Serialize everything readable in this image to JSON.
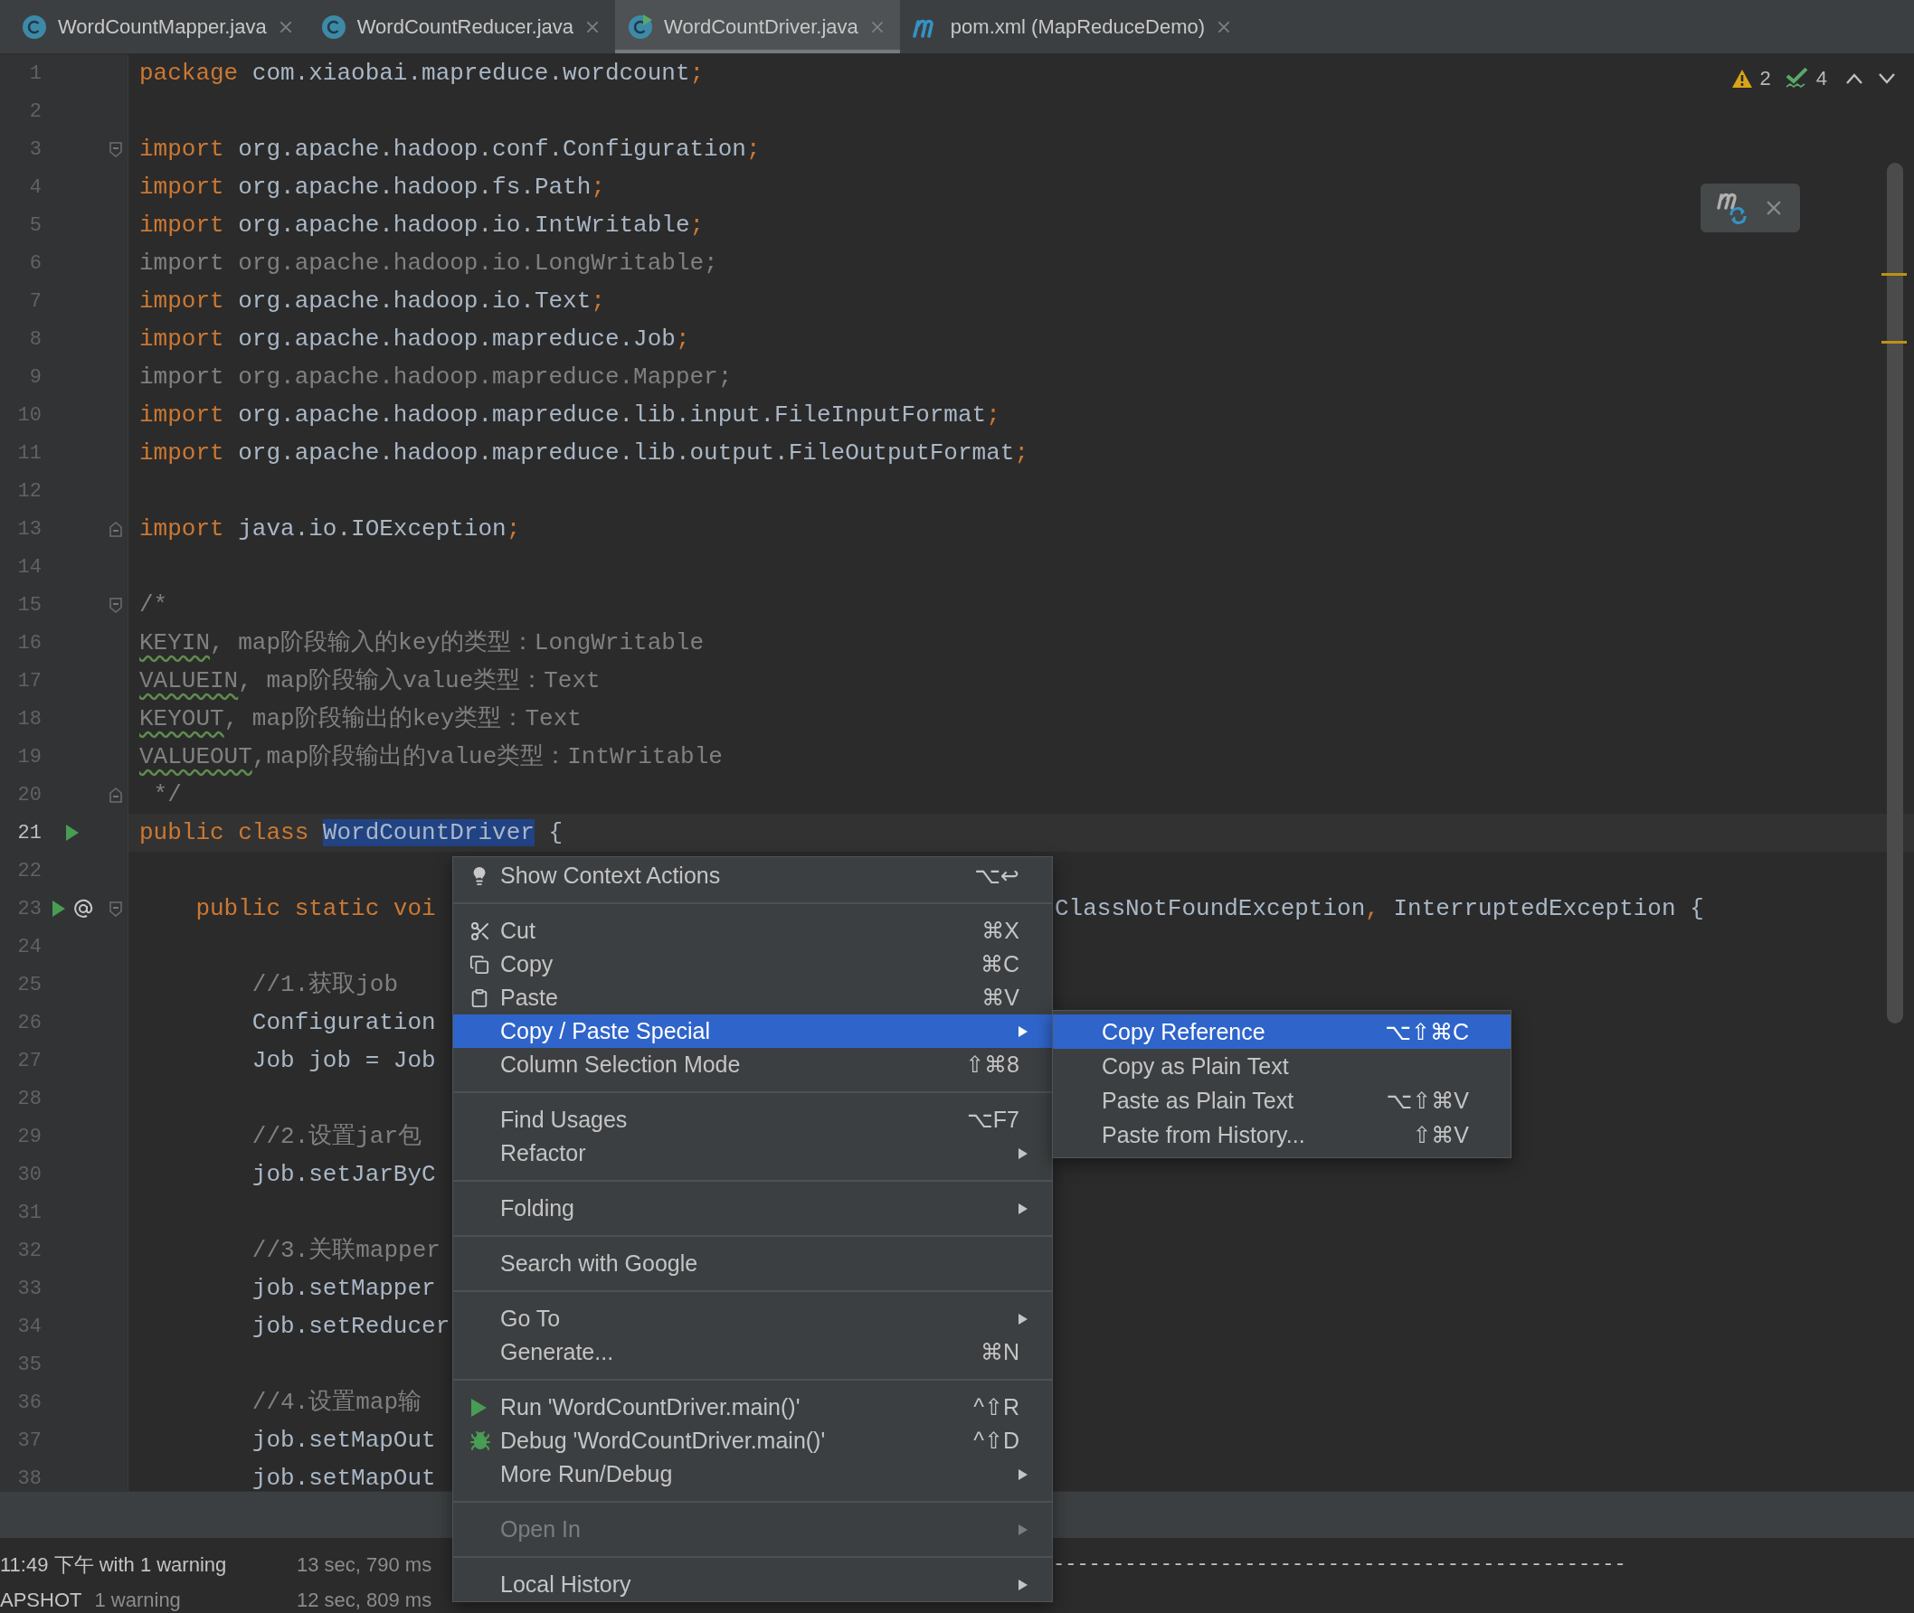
{
  "tabs": [
    {
      "label": "WordCountMapper.java",
      "kind": "class",
      "selected": false
    },
    {
      "label": "WordCountReducer.java",
      "kind": "class",
      "selected": false
    },
    {
      "label": "WordCountDriver.java",
      "kind": "runnable",
      "selected": true
    },
    {
      "label": "pom.xml (MapReduceDemo)",
      "kind": "maven",
      "selected": false
    }
  ],
  "inspections": {
    "warnings": "2",
    "checks": "4"
  },
  "lines": [
    {
      "n": "1",
      "current": false,
      "segments": [
        {
          "kind": "kw",
          "text": "package"
        },
        {
          "kind": "plain",
          "text": " com.xiaobai.mapreduce.wordcount"
        },
        {
          "kind": "kw",
          "text": ";"
        }
      ]
    },
    {
      "n": "2",
      "current": false
    },
    {
      "n": "3",
      "current": false,
      "fold": {
        "kind": "start"
      },
      "segments": [
        {
          "kind": "kw",
          "text": "import"
        },
        {
          "kind": "plain",
          "text": " org.apache.hadoop.conf.Configuration"
        },
        {
          "kind": "kw",
          "text": ";"
        }
      ]
    },
    {
      "n": "4",
      "current": false,
      "segments": [
        {
          "kind": "kw",
          "text": "import"
        },
        {
          "kind": "plain",
          "text": " org.apache.hadoop.fs.Path"
        },
        {
          "kind": "kw",
          "text": ";"
        }
      ]
    },
    {
      "n": "5",
      "current": false,
      "segments": [
        {
          "kind": "kw",
          "text": "import"
        },
        {
          "kind": "plain",
          "text": " org.apache.hadoop.io.IntWritable"
        },
        {
          "kind": "kw",
          "text": ";"
        }
      ]
    },
    {
      "n": "6",
      "current": false,
      "segments": [
        {
          "kind": "unused",
          "text": "import org.apache.hadoop.io.LongWritable;"
        }
      ]
    },
    {
      "n": "7",
      "current": false,
      "segments": [
        {
          "kind": "kw",
          "text": "import"
        },
        {
          "kind": "plain",
          "text": " org.apache.hadoop.io.Text"
        },
        {
          "kind": "kw",
          "text": ";"
        }
      ]
    },
    {
      "n": "8",
      "current": false,
      "segments": [
        {
          "kind": "kw",
          "text": "import"
        },
        {
          "kind": "plain",
          "text": " org.apache.hadoop.mapreduce.Job"
        },
        {
          "kind": "kw",
          "text": ";"
        }
      ]
    },
    {
      "n": "9",
      "current": false,
      "segments": [
        {
          "kind": "unused",
          "text": "import org.apache.hadoop.mapreduce.Mapper;"
        }
      ]
    },
    {
      "n": "10",
      "current": false,
      "segments": [
        {
          "kind": "kw",
          "text": "import"
        },
        {
          "kind": "plain",
          "text": " org.apache.hadoop.mapreduce.lib.input.FileInputFormat"
        },
        {
          "kind": "kw",
          "text": ";"
        }
      ]
    },
    {
      "n": "11",
      "current": false,
      "segments": [
        {
          "kind": "kw",
          "text": "import"
        },
        {
          "kind": "plain",
          "text": " org.apache.hadoop.mapreduce.lib.output.FileOutputFormat"
        },
        {
          "kind": "kw",
          "text": ";"
        }
      ]
    },
    {
      "n": "12",
      "current": false
    },
    {
      "n": "13",
      "current": false,
      "fold": {
        "kind": "end"
      },
      "segments": [
        {
          "kind": "kw",
          "text": "import"
        },
        {
          "kind": "plain",
          "text": " java.io.IOException"
        },
        {
          "kind": "kw",
          "text": ";"
        }
      ]
    },
    {
      "n": "14",
      "current": false
    },
    {
      "n": "15",
      "current": false,
      "fold": {
        "kind": "start"
      },
      "segments": [
        {
          "kind": "comment",
          "text": "/*"
        }
      ]
    },
    {
      "n": "16",
      "current": false,
      "segments": [
        {
          "kind": "typo",
          "text": "KEYIN"
        },
        {
          "kind": "comment",
          "text": ", map阶段输入的key的类型：LongWritable"
        }
      ]
    },
    {
      "n": "17",
      "current": false,
      "segments": [
        {
          "kind": "typo",
          "text": "VALUEIN"
        },
        {
          "kind": "comment",
          "text": ", map阶段输入value类型：Text"
        }
      ]
    },
    {
      "n": "18",
      "current": false,
      "segments": [
        {
          "kind": "typo",
          "text": "KEYOUT"
        },
        {
          "kind": "comment",
          "text": ", map阶段输出的key类型：Text"
        }
      ]
    },
    {
      "n": "19",
      "current": false,
      "segments": [
        {
          "kind": "typo",
          "text": "VALUEOUT"
        },
        {
          "kind": "comment",
          "text": ",map阶段输出的value类型：IntWritable"
        }
      ]
    },
    {
      "n": "20",
      "current": false,
      "fold": {
        "kind": "end"
      },
      "segments": [
        {
          "kind": "comment",
          "text": " */"
        }
      ]
    },
    {
      "n": "21",
      "current": true,
      "markers": [
        {
          "kind": "run"
        }
      ],
      "segments": [
        {
          "kind": "kw",
          "text": "public class "
        },
        {
          "kind": "selected",
          "text": "WordCountDriver"
        },
        {
          "kind": "plain",
          "text": " {"
        }
      ]
    },
    {
      "n": "22",
      "current": false
    },
    {
      "n": "23",
      "current": false,
      "markers": [
        {
          "kind": "run"
        },
        {
          "kind": "override"
        }
      ],
      "fold": {
        "kind": "start"
      },
      "segments": [
        {
          "kind": "kw",
          "text": "    public static voi"
        }
      ],
      "tail": [
        {
          "kind": "plain",
          "text": "ClassNotFoundException"
        },
        {
          "kind": "kw",
          "text": ", "
        },
        {
          "kind": "plain",
          "text": "InterruptedException {"
        }
      ]
    },
    {
      "n": "24",
      "current": false
    },
    {
      "n": "25",
      "current": false,
      "segments": [
        {
          "kind": "comment",
          "text": "        //1.获取job"
        }
      ]
    },
    {
      "n": "26",
      "current": false,
      "segments": [
        {
          "kind": "plain",
          "text": "        Configuration"
        }
      ]
    },
    {
      "n": "27",
      "current": false,
      "segments": [
        {
          "kind": "plain",
          "text": "        Job job = Job"
        }
      ]
    },
    {
      "n": "28",
      "current": false
    },
    {
      "n": "29",
      "current": false,
      "segments": [
        {
          "kind": "comment",
          "text": "        //2.设置jar包"
        }
      ]
    },
    {
      "n": "30",
      "current": false,
      "segments": [
        {
          "kind": "plain",
          "text": "        job.setJarByC"
        }
      ]
    },
    {
      "n": "31",
      "current": false
    },
    {
      "n": "32",
      "current": false,
      "segments": [
        {
          "kind": "comment",
          "text": "        //3.关联mapper"
        }
      ]
    },
    {
      "n": "33",
      "current": false,
      "segments": [
        {
          "kind": "plain",
          "text": "        job.setMapper"
        }
      ]
    },
    {
      "n": "34",
      "current": false,
      "segments": [
        {
          "kind": "plain",
          "text": "        job.setReducer"
        }
      ]
    },
    {
      "n": "35",
      "current": false
    },
    {
      "n": "36",
      "current": false,
      "segments": [
        {
          "kind": "comment",
          "text": "        //4.设置map输"
        }
      ]
    },
    {
      "n": "37",
      "current": false,
      "segments": [
        {
          "kind": "plain",
          "text": "        job.setMapOut"
        }
      ]
    },
    {
      "n": "38",
      "current": false,
      "segments": [
        {
          "kind": "plain",
          "text": "        job.setMapOut"
        }
      ]
    }
  ],
  "context_menu": {
    "groups": [
      {
        "items": [
          {
            "label": "Show Context Actions",
            "shortcut": "⌥↩",
            "kind": "bulb",
            "submenu": false,
            "selected": false,
            "disabled": false
          }
        ]
      },
      {
        "items": [
          {
            "label": "Cut",
            "shortcut": "⌘X",
            "kind": "cut",
            "submenu": false,
            "selected": false,
            "disabled": false
          },
          {
            "label": "Copy",
            "shortcut": "⌘C",
            "kind": "copy",
            "submenu": false,
            "selected": false,
            "disabled": false
          },
          {
            "label": "Paste",
            "shortcut": "⌘V",
            "kind": "paste",
            "submenu": false,
            "selected": false,
            "disabled": false
          },
          {
            "label": "Copy / Paste Special",
            "submenu": true,
            "selected": true,
            "disabled": false
          },
          {
            "label": "Column Selection Mode",
            "shortcut": "⇧⌘8",
            "submenu": false,
            "selected": false,
            "disabled": false
          }
        ]
      },
      {
        "items": [
          {
            "label": "Find Usages",
            "shortcut": "⌥F7",
            "submenu": false,
            "selected": false,
            "disabled": false
          },
          {
            "label": "Refactor",
            "submenu": true,
            "selected": false,
            "disabled": false
          }
        ]
      },
      {
        "items": [
          {
            "label": "Folding",
            "submenu": true,
            "selected": false,
            "disabled": false
          }
        ]
      },
      {
        "items": [
          {
            "label": "Search with Google",
            "submenu": false,
            "selected": false,
            "disabled": false
          }
        ]
      },
      {
        "items": [
          {
            "label": "Go To",
            "submenu": true,
            "selected": false,
            "disabled": false
          },
          {
            "label": "Generate...",
            "shortcut": "⌘N",
            "submenu": false,
            "selected": false,
            "disabled": false
          }
        ]
      },
      {
        "items": [
          {
            "label": "Run 'WordCountDriver.main()'",
            "shortcut": "^⇧R",
            "kind": "run",
            "submenu": false,
            "selected": false,
            "disabled": false
          },
          {
            "label": "Debug 'WordCountDriver.main()'",
            "shortcut": "^⇧D",
            "kind": "debug",
            "submenu": false,
            "selected": false,
            "disabled": false
          },
          {
            "label": "More Run/Debug",
            "submenu": true,
            "selected": false,
            "disabled": false
          }
        ]
      },
      {
        "items": [
          {
            "label": "Open In",
            "submenu": true,
            "selected": false,
            "disabled": true
          }
        ]
      },
      {
        "items": [
          {
            "label": "Local History",
            "submenu": true,
            "selected": false,
            "disabled": false
          }
        ]
      }
    ]
  },
  "submenu": {
    "items": [
      {
        "label": "Copy Reference",
        "shortcut": "⌥⇧⌘C",
        "selected": true
      },
      {
        "label": "Copy as Plain Text",
        "selected": false
      },
      {
        "label": "Paste as Plain Text",
        "shortcut": "⌥⇧⌘V",
        "selected": false
      },
      {
        "label": "Paste from History...",
        "shortcut": "⇧⌘V",
        "selected": false
      }
    ]
  },
  "build_output": {
    "rows": [
      {
        "title": "11:49 下午 with 1 warning",
        "time": "13 sec, 790 ms"
      },
      {
        "title": "APSHOT",
        "note": "1 warning",
        "time": "12 sec, 809 ms"
      }
    ]
  },
  "console": {
    "lines": [
      "------------------------------------------------"
    ]
  }
}
